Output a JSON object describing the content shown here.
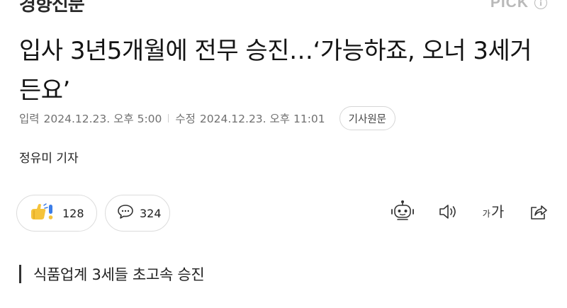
{
  "header": {
    "press_name": "경향신문",
    "pick_label": "PICK",
    "info_icon_glyph": "i"
  },
  "article": {
    "headline": "입사 3년5개월에 전무 승진…‘가능하죠, 오너 3세거든요’",
    "published_label": "입력",
    "published_at": "2024.12.23. 오후 5:00",
    "modified_label": "수정",
    "modified_at": "2024.12.23. 오후 11:01",
    "original_button": "기사원문",
    "reporter": "정유미 기자",
    "subheading": "식품업계 3세들 초고속 승진"
  },
  "actions": {
    "reaction_count": "128",
    "comment_count": "324",
    "font_size_small": "가",
    "font_size_large": "가"
  },
  "icons": {
    "reaction": "thumbs-up-exclaim-icon",
    "comment": "speech-bubble-icon",
    "summary": "robot-icon",
    "listen": "speaker-icon",
    "font": "font-size-icon",
    "share": "share-icon"
  },
  "colors": {
    "text": "#111111",
    "meta": "#707070",
    "border": "#dcdcdc",
    "pick": "#b9b9b9",
    "reaction_yellow": "#f5c33b",
    "reaction_blue": "#3b7de8"
  }
}
